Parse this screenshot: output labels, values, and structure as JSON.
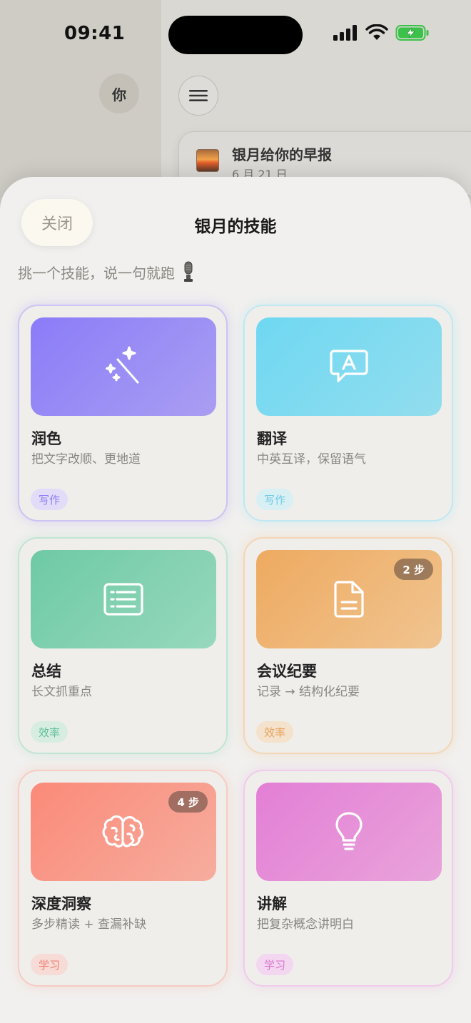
{
  "status_bar": {
    "time": "09:41"
  },
  "background": {
    "avatar_label": "你",
    "report": {
      "title": "银月给你的早报",
      "date": "6 月 21 日"
    }
  },
  "sheet": {
    "close_label": "关闭",
    "title": "银月的技能",
    "subtitle": "挑一个技能，说一句就跑",
    "skills": [
      {
        "name": "润色",
        "desc": "把文字改顺、更地道",
        "tag": "写作",
        "steps": "",
        "icon": "magic-wand-icon",
        "accent": "#8b7cf6"
      },
      {
        "name": "翻译",
        "desc": "中英互译，保留语气",
        "tag": "写作",
        "steps": "",
        "icon": "translate-bubble-icon",
        "accent": "#6fd6ee"
      },
      {
        "name": "总结",
        "desc": "长文抓重点",
        "tag": "效率",
        "steps": "",
        "icon": "list-doc-icon",
        "accent": "#6fcaa4"
      },
      {
        "name": "会议纪要",
        "desc": "记录 → 结构化纪要",
        "tag": "效率",
        "steps": "2 步",
        "icon": "document-icon",
        "accent": "#eea85e"
      },
      {
        "name": "深度洞察",
        "desc": "多步精读 + 查漏补缺",
        "tag": "学习",
        "steps": "4 步",
        "icon": "brain-icon",
        "accent": "#fb8b7b"
      },
      {
        "name": "讲解",
        "desc": "把复杂概念讲明白",
        "tag": "学习",
        "steps": "",
        "icon": "lightbulb-icon",
        "accent": "#e07fd6"
      }
    ]
  }
}
